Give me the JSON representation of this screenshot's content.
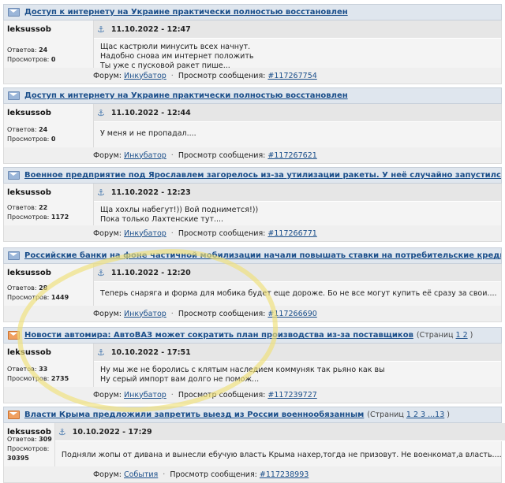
{
  "common": {
    "author": "leksussob",
    "answers_label": "Ответов:",
    "views_label": "Просмотров:",
    "forum_label": "Форум:",
    "view_msg_label": "Просмотр сообщения:",
    "pages_label": "(Страниц",
    "pages_close": ")"
  },
  "posts": [
    {
      "title": "Доступ к интернету на Украине практически полностью восстановлен",
      "date": "11.10.2022 - 12:47",
      "answers": "24",
      "views": "0",
      "lines": [
        "Щас кастрюли минусить всех начнут.",
        "Надобно снова им интернет положить",
        "Ты уже с пусковой ракет пише..."
      ],
      "forum": "Инкубатор",
      "msg_id": "#117267754"
    },
    {
      "title": "Доступ к интернету на Украине практически полностью восстановлен",
      "date": "11.10.2022 - 12:44",
      "answers": "24",
      "views": "0",
      "lines": [
        "У меня и не пропадал...."
      ],
      "forum": "Инкубатор",
      "msg_id": "#117267621"
    },
    {
      "title": "Военное предприятие под Ярославлем загорелось из-за утилизации ракеты. У неё случайно запустился двигатель",
      "date": "11.10.2022 - 12:23",
      "answers": "22",
      "views": "1172",
      "lines": [
        "Ща хохлы набегут!)) Вой поднимется!))",
        "Пока только Лахтенские тут...."
      ],
      "forum": "Инкубатор",
      "msg_id": "#117266771"
    },
    {
      "title": "Российские банки на фоне частичной мобилизации начали повышать ставки на потребительские кредиты",
      "pages": "1 2",
      "date": "11.10.2022 - 12:20",
      "answers": "28",
      "views": "1449",
      "lines": [
        "Теперь снаряга и форма для мобика будет еще дороже. Бо не все могут купить её сразу за свои...."
      ],
      "forum": "Инкубатор",
      "msg_id": "#117266690"
    },
    {
      "title": "Новости автомира: АвтоВАЗ может сократить план производства из-за поставщиков",
      "pages": "1 2",
      "date": "10.10.2022 - 17:51",
      "answers": "33",
      "views": "2735",
      "lines": [
        "Ну мы же не боролись с клятым наследием коммуняк так рьяно как вы",
        "Ну серый импорт вам долго не помож..."
      ],
      "forum": "Инкубатор",
      "msg_id": "#117239727"
    },
    {
      "title": "Власти Крыма предложили запретить выезд из России военнообязанным",
      "pages": "1 2 3 ...13",
      "date": "10.10.2022 - 17:29",
      "answers": "309",
      "views": "30395",
      "lines": [
        "Подняли жопы от дивана и вынесли ебучую власть Крыма нахер,тогда не призовут. Не военкомат,а власть...."
      ],
      "forum": "События",
      "msg_id": "#117238993"
    }
  ]
}
